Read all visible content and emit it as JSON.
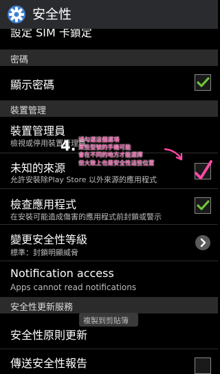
{
  "title": "安全性",
  "top_cut_item": "設定 SIM 卡鎖定",
  "sections": {
    "password": "密碼",
    "device_admin": "裝置管理",
    "security_update": "安全性更新服務"
  },
  "items": {
    "show_password": {
      "label": "顯示密碼",
      "checked": true
    },
    "device_administrators": {
      "label": "裝置管理員",
      "summary": "檢視或停用裝置管理員"
    },
    "unknown_sources": {
      "label": "未知的來源",
      "summary": "允許安裝除Play Store 以外來源的應用程式",
      "checked": true
    },
    "verify_apps": {
      "label": "檢查應用程式",
      "summary": "在安裝可能造成傷害的應用程式前封鎖或警示",
      "checked": true
    },
    "change_security_level": {
      "label": "變更安全性等級",
      "summary": "標準：封鎖明顯威脅"
    },
    "notification_access": {
      "label": "Notification access",
      "summary": "Apps cannot read notifications"
    },
    "security_policy_update": {
      "label": "安全性原則更新"
    },
    "send_security_report": {
      "label": "傳送安全性報告",
      "checked": false
    }
  },
  "annotation": {
    "number": "4.",
    "lines": [
      "請勾選這個選項",
      "某些型號的手機可能",
      "會在不同的地方才能選擇",
      "但大致上也是安全性這些位置"
    ],
    "color": "#ff49a6"
  },
  "toast": "複製到剪貼簿",
  "colors": {
    "check_green": "#6ec23b",
    "section_bg": "#2b2b2b",
    "actionbar_bg": "#2a2b2f"
  }
}
